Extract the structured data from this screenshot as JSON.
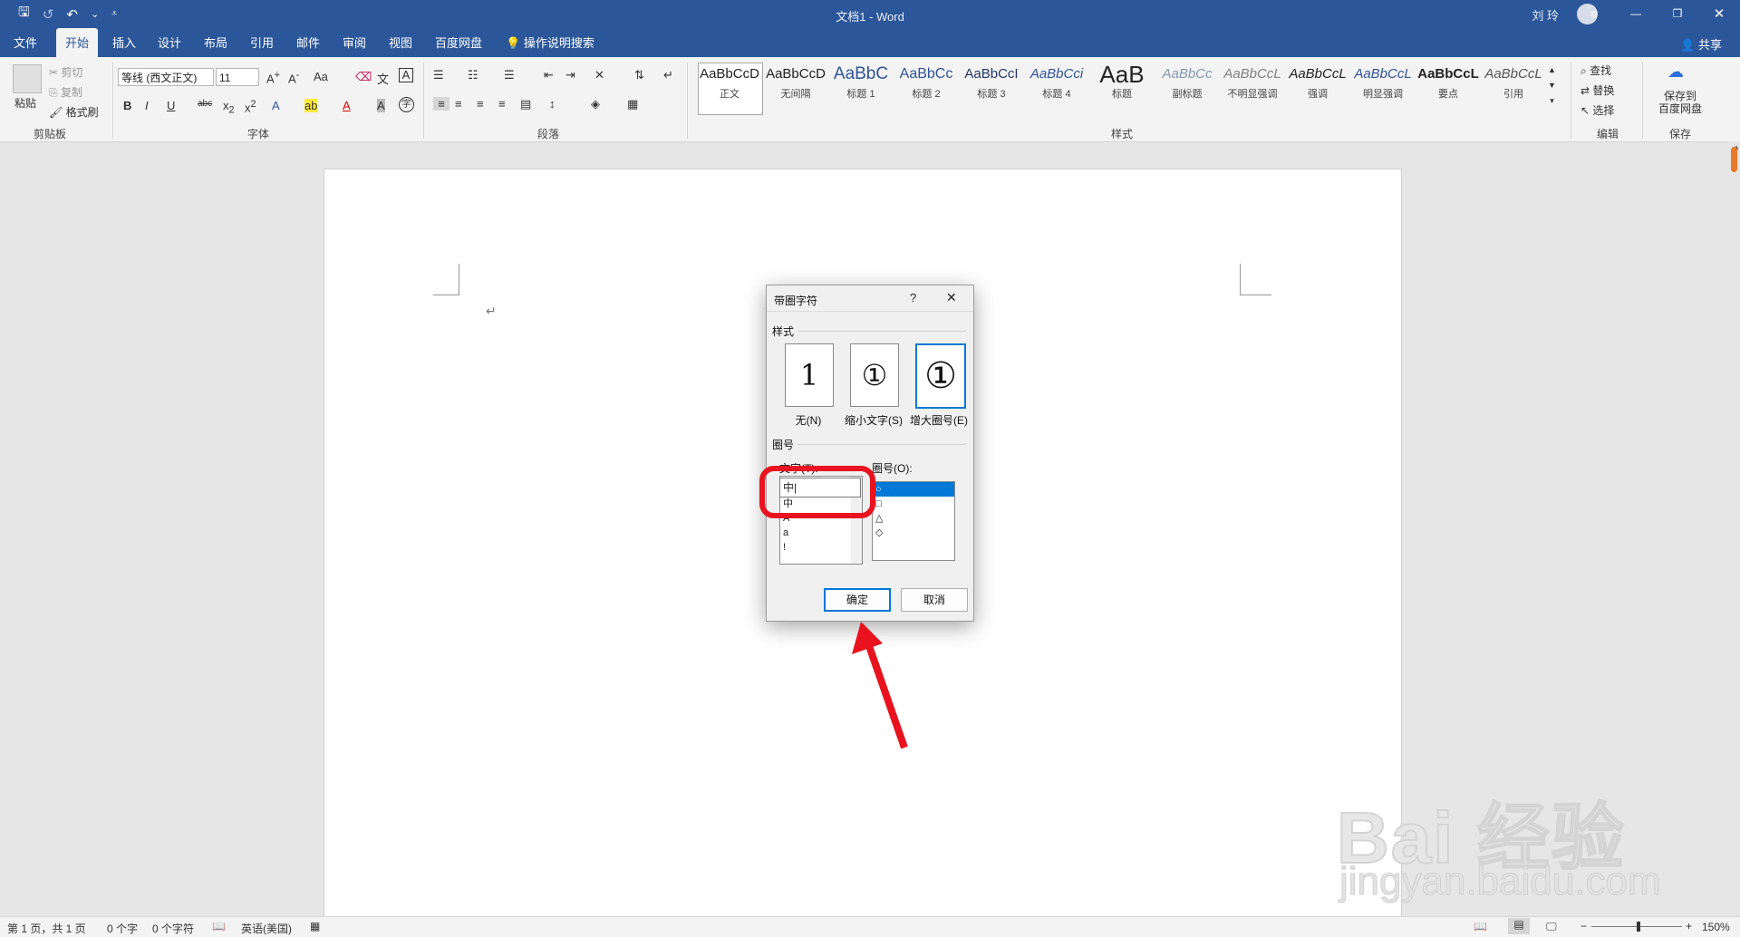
{
  "window": {
    "doc_title": "文档1",
    "app_name": "Word",
    "user": "刘 玲"
  },
  "quick_access": {
    "save": "🖫",
    "redo": "↺",
    "undo": "↶",
    "undo_menu": "⌄",
    "customize": "⩡"
  },
  "window_controls": {
    "ribbon_display": "⧈",
    "minimize": "—",
    "restore": "❐",
    "close": "✕"
  },
  "tabs": [
    "文件",
    "开始",
    "插入",
    "设计",
    "布局",
    "引用",
    "邮件",
    "审阅",
    "视图",
    "百度网盘"
  ],
  "tell_me": "操作说明搜索",
  "share": "共享",
  "clipboard": {
    "paste": "粘贴",
    "cut": "剪切",
    "copy": "复制",
    "format_painter": "格式刷",
    "group": "剪贴板"
  },
  "font": {
    "name": "等线 (西文正文)",
    "size": "11",
    "group": "字体"
  },
  "paragraph": {
    "group": "段落"
  },
  "styles": {
    "group": "样式",
    "items": [
      {
        "sample": "AaBbCcD",
        "name": "正文"
      },
      {
        "sample": "AaBbCcD",
        "name": "无间隔"
      },
      {
        "sample": "AaBbC",
        "name": "标题 1"
      },
      {
        "sample": "AaBbCc",
        "name": "标题 2"
      },
      {
        "sample": "AaBbCcI",
        "name": "标题 3"
      },
      {
        "sample": "AaBbCci",
        "name": "标题 4"
      },
      {
        "sample": "AaB",
        "name": "标题"
      },
      {
        "sample": "AaBbCc",
        "name": "副标题"
      },
      {
        "sample": "AaBbCcL",
        "name": "不明显强调"
      },
      {
        "sample": "AaBbCcL",
        "name": "强调"
      },
      {
        "sample": "AaBbCcL",
        "name": "明显强调"
      },
      {
        "sample": "AaBbCcL",
        "name": "要点"
      },
      {
        "sample": "AaBbCcL",
        "name": "引用"
      }
    ]
  },
  "editing": {
    "find": "查找",
    "replace": "替换",
    "select": "选择",
    "group": "编辑"
  },
  "save_group": {
    "label_line1": "保存到",
    "label_line2": "百度网盘",
    "group": "保存"
  },
  "status": {
    "page": "第 1 页，共 1 页",
    "words": "0 个字",
    "chars": "0 个字符",
    "language": "英语(美国)",
    "zoom": "150%"
  },
  "dialog": {
    "title": "带圈字符",
    "help": "?",
    "close": "✕",
    "style_section": "样式",
    "options": [
      {
        "glyph": "1",
        "label": "无(N)"
      },
      {
        "glyph": "①",
        "label": "缩小文字(S)"
      },
      {
        "glyph": "①",
        "label": "增大圈号(E)"
      }
    ],
    "ring_section": "圈号",
    "text_label": "文字(T):",
    "text_value": "中",
    "text_list": [
      "中",
      "A",
      "a",
      "!"
    ],
    "ring_label": "圈号(O):",
    "ring_list": [
      "○",
      "□",
      "△",
      "◇"
    ],
    "ok": "确定",
    "cancel": "取消"
  },
  "watermark": {
    "brand": "Bai 经验",
    "url": "jingyan.baidu.com"
  },
  "colors": {
    "accent": "#2b579a",
    "annotation": "#e8131e"
  }
}
